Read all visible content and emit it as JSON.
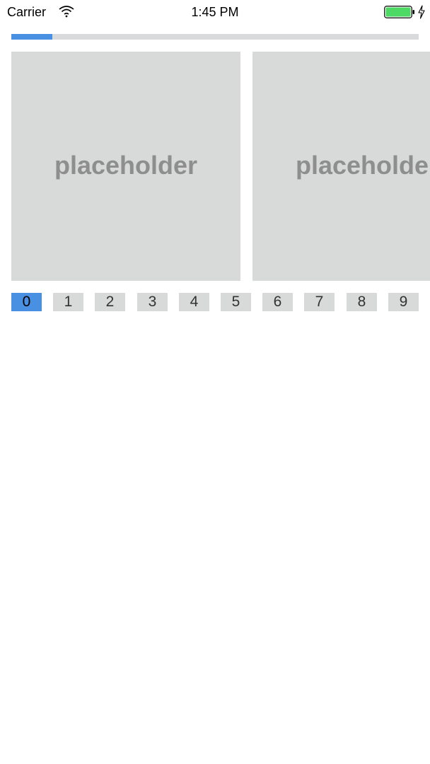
{
  "status_bar": {
    "carrier": "Carrier",
    "time": "1:45 PM",
    "battery_color": "#4cd964"
  },
  "progress": {
    "value": 0.1,
    "fill_color": "#4a90e2",
    "track_color": "#d8dadb"
  },
  "carousel": {
    "slides": [
      {
        "label": "placeholder"
      },
      {
        "label": "placeholder"
      }
    ]
  },
  "pages": {
    "selected": 0,
    "items": [
      "0",
      "1",
      "2",
      "3",
      "4",
      "5",
      "6",
      "7",
      "8",
      "9"
    ]
  }
}
